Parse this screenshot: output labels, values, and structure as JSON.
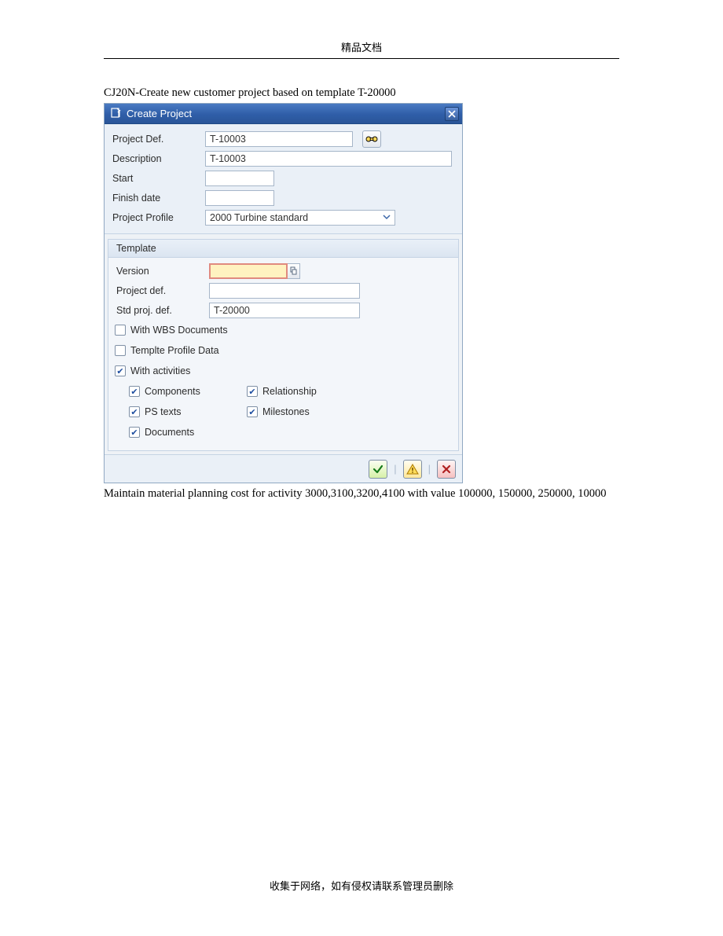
{
  "doc": {
    "header": "精品文档",
    "footer": "收集于网络，如有侵权请联系管理员删除",
    "caption": "CJ20N-Create new customer project based on template T-20000",
    "post_text": "Maintain material planning cost for activity 3000,3100,3200,4100 with value 100000, 150000, 250000, 10000"
  },
  "dialog": {
    "title": "Create Project",
    "fields": {
      "project_def_label": "Project Def.",
      "project_def_value": "T-10003",
      "description_label": "Description",
      "description_value": "T-10003",
      "start_label": "Start",
      "start_value": "",
      "finish_label": "Finish date",
      "finish_value": "",
      "profile_label": "Project Profile",
      "profile_value": "2000 Turbine standard"
    },
    "template": {
      "section_title": "Template",
      "version_label": "Version",
      "version_value": "",
      "project_def_label": "Project def.",
      "project_def_value": "",
      "std_proj_label": "Std proj. def.",
      "std_proj_value": "T-20000",
      "cb_wbs_docs": "With WBS Documents",
      "cb_profile_data": "Templte Profile Data",
      "cb_with_activities": "With activities",
      "cb_components": "Components",
      "cb_relationship": "Relationship",
      "cb_ps_texts": "PS texts",
      "cb_milestones": "Milestones",
      "cb_documents": "Documents"
    }
  }
}
